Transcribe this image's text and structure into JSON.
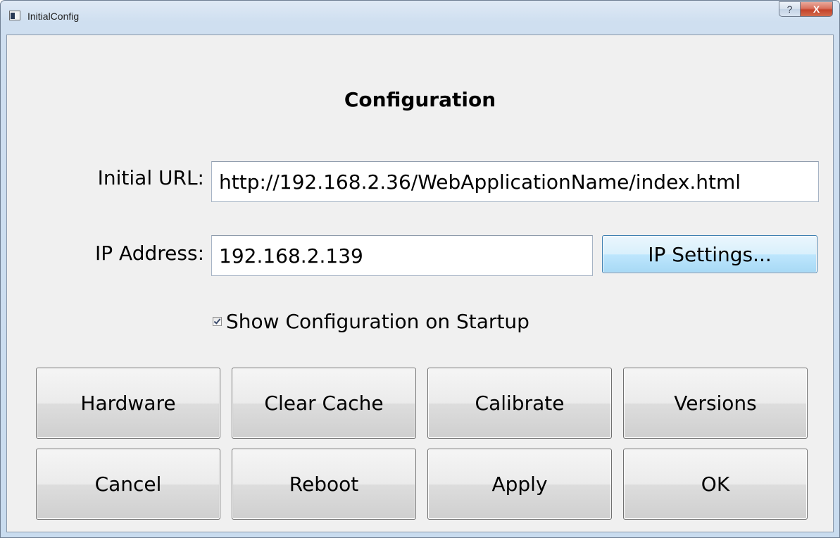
{
  "window": {
    "title": "InitialConfig",
    "help_label": "?",
    "close_label": "X"
  },
  "form": {
    "heading": "Configuration",
    "initial_url_label": "Initial URL:",
    "initial_url_value": "http://192.168.2.36/WebApplicationName/index.html",
    "ip_address_label": "IP Address:",
    "ip_address_value": "192.168.2.139",
    "ip_settings_button": "IP Settings...",
    "show_config_checkbox_label": "Show Configuration on Startup",
    "show_config_checked": true
  },
  "buttons": {
    "row1": [
      "Hardware",
      "Clear Cache",
      "Calibrate",
      "Versions"
    ],
    "row2": [
      "Cancel",
      "Reboot",
      "Apply",
      "OK"
    ]
  }
}
